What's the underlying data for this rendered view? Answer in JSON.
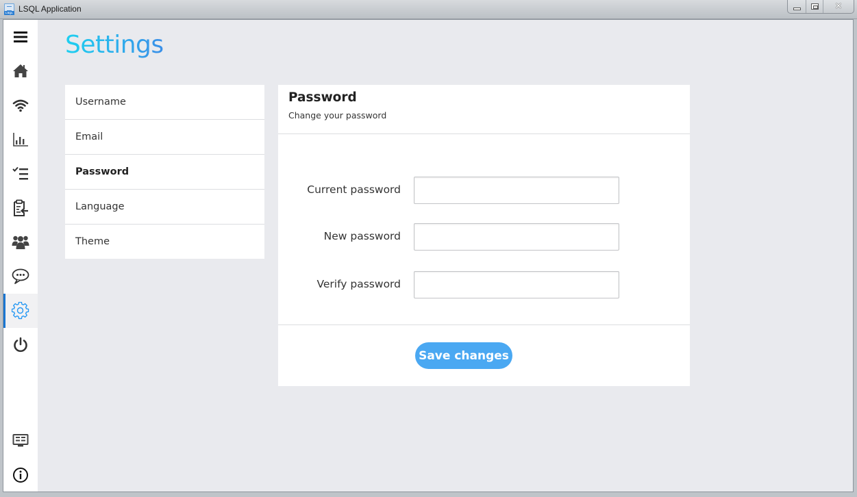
{
  "window": {
    "title": "LSQL Application",
    "app_icon_badge": "LSQL",
    "controls": [
      {
        "name": "minimize",
        "icon": "minimize-icon"
      },
      {
        "name": "maximize",
        "icon": "maximize-icon"
      },
      {
        "name": "close",
        "icon": "close-icon",
        "glyph": "✕"
      }
    ]
  },
  "sidebar": {
    "items": [
      {
        "id": "menu",
        "icon": "hamburger-menu-icon"
      },
      {
        "id": "home",
        "icon": "home-icon"
      },
      {
        "id": "network",
        "icon": "wifi-icon"
      },
      {
        "id": "statistics",
        "icon": "bar-chart-icon"
      },
      {
        "id": "tasks",
        "icon": "checklist-icon"
      },
      {
        "id": "clipboard",
        "icon": "clipboard-import-icon"
      },
      {
        "id": "users",
        "icon": "users-group-icon"
      },
      {
        "id": "chat",
        "icon": "chat-bubble-icon"
      },
      {
        "id": "settings",
        "icon": "gear-icon",
        "active": true
      },
      {
        "id": "power",
        "icon": "power-icon"
      },
      {
        "id": "dashboard",
        "icon": "dashboard-monitor-icon"
      },
      {
        "id": "info",
        "icon": "info-icon"
      }
    ],
    "accent_color": "#1976d2"
  },
  "page": {
    "title": "Settings",
    "title_gradient": [
      "#1ed0f0",
      "#3a8fe8"
    ]
  },
  "settings_menu": {
    "items": [
      {
        "label": "Username",
        "active": false
      },
      {
        "label": "Email",
        "active": false
      },
      {
        "label": "Password",
        "active": true
      },
      {
        "label": "Language",
        "active": false
      },
      {
        "label": "Theme",
        "active": false
      }
    ]
  },
  "panel": {
    "title": "Password",
    "subtitle": "Change your password",
    "fields": [
      {
        "label": "Current password",
        "value": "",
        "placeholder": ""
      },
      {
        "label": "New password",
        "value": "",
        "placeholder": ""
      },
      {
        "label": "Verify password",
        "value": "",
        "placeholder": ""
      }
    ],
    "save_label": "Save changes",
    "save_color": "#4aa8f2"
  }
}
